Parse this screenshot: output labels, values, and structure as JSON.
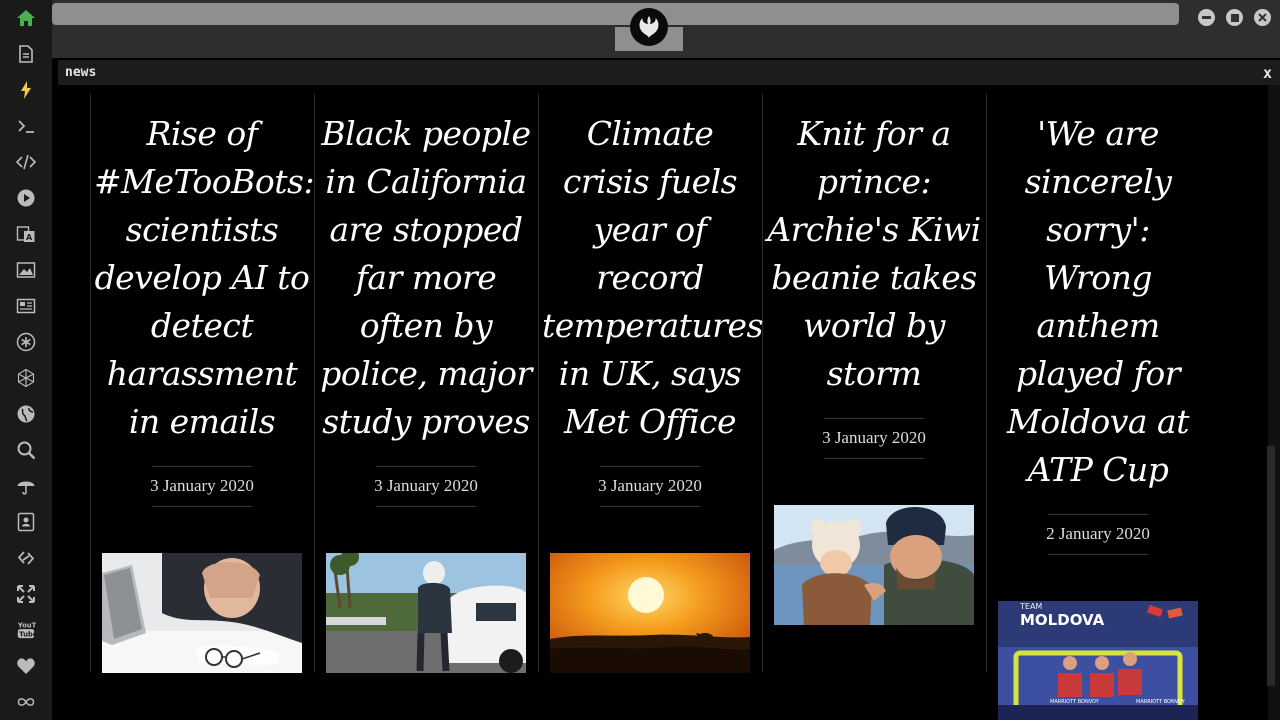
{
  "sidebar": {
    "items": [
      {
        "icon": "home-icon",
        "color": "#4caf50"
      },
      {
        "icon": "document-icon"
      },
      {
        "icon": "lightning-icon",
        "color": "#f2c94c"
      },
      {
        "icon": "terminal-icon"
      },
      {
        "icon": "code-icon"
      },
      {
        "icon": "play-icon"
      },
      {
        "icon": "translate-icon"
      },
      {
        "icon": "image-icon"
      },
      {
        "icon": "newspaper-icon"
      },
      {
        "icon": "asterisk-icon"
      },
      {
        "icon": "hexagon-icon"
      },
      {
        "icon": "globe-icon"
      },
      {
        "icon": "search-icon"
      },
      {
        "icon": "umbrella-icon"
      },
      {
        "icon": "contacts-icon"
      },
      {
        "icon": "link-icon"
      },
      {
        "icon": "expand-icon"
      },
      {
        "icon": "youtube-icon",
        "label": "YouTube"
      },
      {
        "icon": "heart-icon"
      },
      {
        "icon": "infinity-icon"
      }
    ]
  },
  "window": {
    "title": "news",
    "close_label": "x"
  },
  "articles": [
    {
      "headline": "Rise of #MeTooBots: scientists develop AI to detect harassment in emails",
      "date": "3 January 2020",
      "image": "stressed-man-laptop-photo"
    },
    {
      "headline": "Black people in California are stopped far more often by police, major study proves",
      "date": "3 January 2020",
      "image": "police-officer-car-photo"
    },
    {
      "headline": "Climate crisis fuels year of record temperatures in UK, says Met Office",
      "date": "3 January 2020",
      "image": "orange-sunset-sheep-photo"
    },
    {
      "headline": "Knit for a prince: Archie's Kiwi beanie takes world by storm",
      "date": "3 January 2020",
      "image": "father-baby-beanie-photo"
    },
    {
      "headline": "'We are sincerely sorry': Wrong anthem played for Moldova at ATP Cup",
      "date": "2 January 2020",
      "image": "team-moldova-bench-photo",
      "image_texts": {
        "team": "TEAM",
        "country": "MOLDOVA",
        "sponsor": "MARRIOTT BONVOY"
      }
    }
  ]
}
